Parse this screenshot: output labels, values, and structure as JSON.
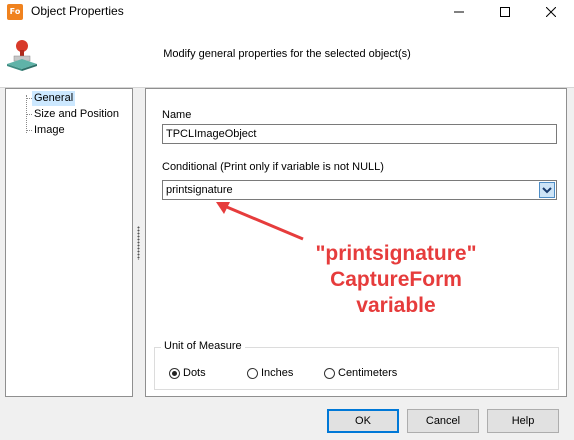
{
  "window": {
    "app_icon_text": "Fo",
    "title": "Object Properties"
  },
  "header": {
    "description": "Modify general properties for the selected object(s)"
  },
  "tree": {
    "items": [
      {
        "label": "General",
        "selected": true
      },
      {
        "label": "Size and Position",
        "selected": false
      },
      {
        "label": "Image",
        "selected": false
      }
    ]
  },
  "general": {
    "name_label": "Name",
    "name_value": "TPCLImageObject",
    "conditional_label": "Conditional (Print only if variable is not NULL)",
    "conditional_value": "printsignature",
    "unit_group_label": "Unit of Measure",
    "units": [
      {
        "label": "Dots",
        "checked": true
      },
      {
        "label": "Inches",
        "checked": false
      },
      {
        "label": "Centimeters",
        "checked": false
      }
    ]
  },
  "annotation": {
    "line1": "\"printsignature\"",
    "line2": "CaptureForm",
    "line3": "variable",
    "color": "#e63c3c"
  },
  "buttons": {
    "ok": "OK",
    "cancel": "Cancel",
    "help": "Help"
  },
  "colors": {
    "accent": "#0078d7",
    "selection": "#cce8ff"
  }
}
